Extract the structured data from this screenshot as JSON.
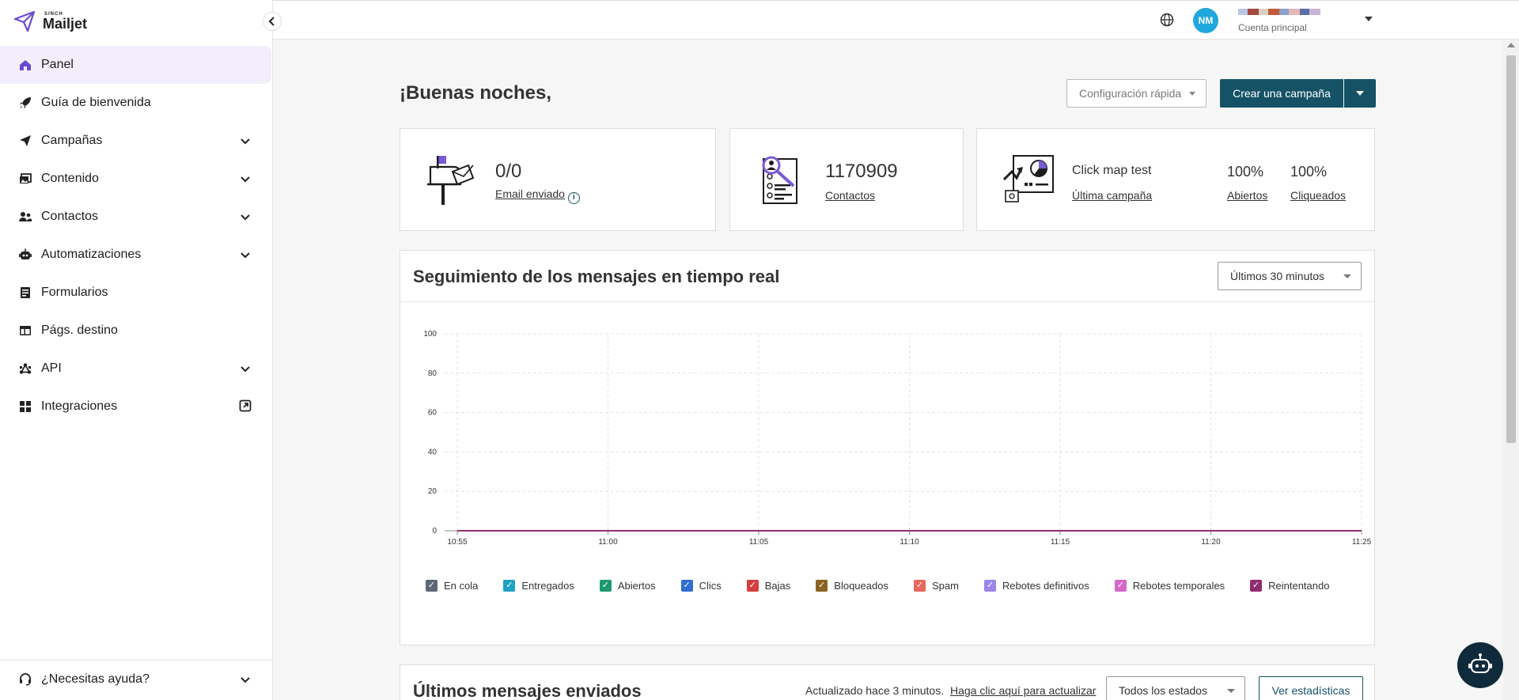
{
  "brand": {
    "sub": "SINCH",
    "name": "Mailjet"
  },
  "sidebar": {
    "items": [
      {
        "label": "Panel",
        "icon": "home-icon",
        "active": true,
        "chevron": false
      },
      {
        "label": "Guía de bienvenida",
        "icon": "rocket-icon",
        "chevron": false
      },
      {
        "label": "Campañas",
        "icon": "paper-plane-icon",
        "chevron": true
      },
      {
        "label": "Contenido",
        "icon": "image-icon",
        "chevron": true
      },
      {
        "label": "Contactos",
        "icon": "contacts-icon",
        "chevron": true
      },
      {
        "label": "Automatizaciones",
        "icon": "robot-icon",
        "chevron": true
      },
      {
        "label": "Formularios",
        "icon": "form-icon",
        "chevron": false
      },
      {
        "label": "Págs. destino",
        "icon": "layout-icon",
        "chevron": false
      },
      {
        "label": "API",
        "icon": "api-icon",
        "chevron": true
      },
      {
        "label": "Integraciones",
        "icon": "grid-icon",
        "external": true
      }
    ],
    "help": "¿Necesitas ayuda?"
  },
  "topbar": {
    "avatar_initials": "NM",
    "account_label": "Cuenta principal",
    "account_swatches": [
      "#b9c6e3",
      "#a34a40",
      "#d9cfc5",
      "#c45a3c",
      "#8da0c9",
      "#e2b8b8",
      "#5e6fa6",
      "#c9b4d6"
    ]
  },
  "main": {
    "greeting": "¡Buenas noches,",
    "quick_config": "Configuración rápida",
    "create_campaign": "Crear una campaña"
  },
  "stats": {
    "sent_value": "0/0",
    "sent_label": "Email enviado",
    "contacts_value": "1170909",
    "contacts_label": "Contactos",
    "campaign_name": "Click map test",
    "campaign_label": "Última campaña",
    "opened_pct": "100%",
    "opened_label": "Abiertos",
    "clicked_pct": "100%",
    "clicked_label": "Cliqueados"
  },
  "tracking": {
    "title": "Seguimiento de los mensajes en tiempo real",
    "range": "Últimos 30 minutos"
  },
  "chart_data": {
    "type": "line",
    "x": [
      "10:55",
      "11:00",
      "11:05",
      "11:10",
      "11:15",
      "11:20",
      "11:25"
    ],
    "ylim": [
      0,
      100
    ],
    "yticks": [
      0,
      20,
      40,
      60,
      80,
      100
    ],
    "grid": true,
    "legend_position": "bottom",
    "series": [
      {
        "name": "En cola",
        "color": "#5d6873",
        "values": [
          0,
          0,
          0,
          0,
          0,
          0,
          0
        ]
      },
      {
        "name": "Entregados",
        "color": "#1fa3c2",
        "values": [
          0,
          0,
          0,
          0,
          0,
          0,
          0
        ]
      },
      {
        "name": "Abiertos",
        "color": "#1e9a6e",
        "values": [
          0,
          0,
          0,
          0,
          0,
          0,
          0
        ]
      },
      {
        "name": "Clics",
        "color": "#2f6fd1",
        "values": [
          0,
          0,
          0,
          0,
          0,
          0,
          0
        ]
      },
      {
        "name": "Bajas",
        "color": "#d23f3f",
        "values": [
          0,
          0,
          0,
          0,
          0,
          0,
          0
        ]
      },
      {
        "name": "Bloqueados",
        "color": "#8a6420",
        "values": [
          0,
          0,
          0,
          0,
          0,
          0,
          0
        ]
      },
      {
        "name": "Spam",
        "color": "#e7675f",
        "values": [
          0,
          0,
          0,
          0,
          0,
          0,
          0
        ]
      },
      {
        "name": "Rebotes definitivos",
        "color": "#9c86e6",
        "values": [
          0,
          0,
          0,
          0,
          0,
          0,
          0
        ]
      },
      {
        "name": "Rebotes temporales",
        "color": "#d468c8",
        "values": [
          0,
          0,
          0,
          0,
          0,
          0,
          0
        ]
      },
      {
        "name": "Reintentando",
        "color": "#8f2e6e",
        "values": [
          0,
          0,
          0,
          0,
          0,
          0,
          0
        ]
      }
    ]
  },
  "sent": {
    "title": "Últimos mensajes enviados",
    "updated": "Actualizado hace 3 minutos.",
    "refresh_link": "Haga clic aquí para actualizar",
    "filter": "Todos los estados",
    "stats_button": "Ver estadísticas"
  }
}
